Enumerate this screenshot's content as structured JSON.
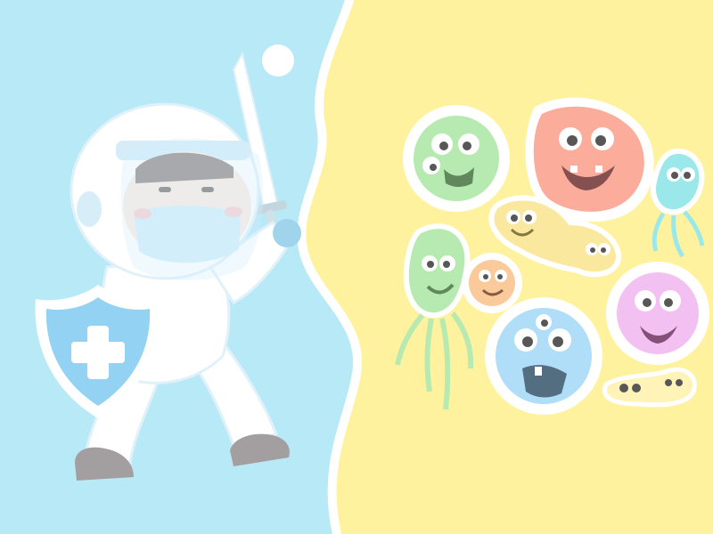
{
  "scene": {
    "colors": {
      "left_bg": "#a9e4f6",
      "right_bg": "#fef08a",
      "divider": "#ffffff",
      "suit": "#ffffff",
      "suit_shade": "#d9eef8",
      "visor": "#c8ecfb",
      "shield": "#7cc8f0",
      "boot": "#8f8a8c",
      "germ_green": "#a8e6a0",
      "germ_red": "#fb9a84",
      "germ_cyan": "#86e3e6",
      "germ_yellow": "#fbe38a",
      "germ_orange": "#fbbf86",
      "germ_purple": "#f0b4ee",
      "germ_blue": "#9fd7f7",
      "germ_light_yellow": "#fff1a8"
    },
    "icons": [
      "astronaut-doctor-icon",
      "shield-cross-icon",
      "sword-icon",
      "germ-icon"
    ]
  }
}
